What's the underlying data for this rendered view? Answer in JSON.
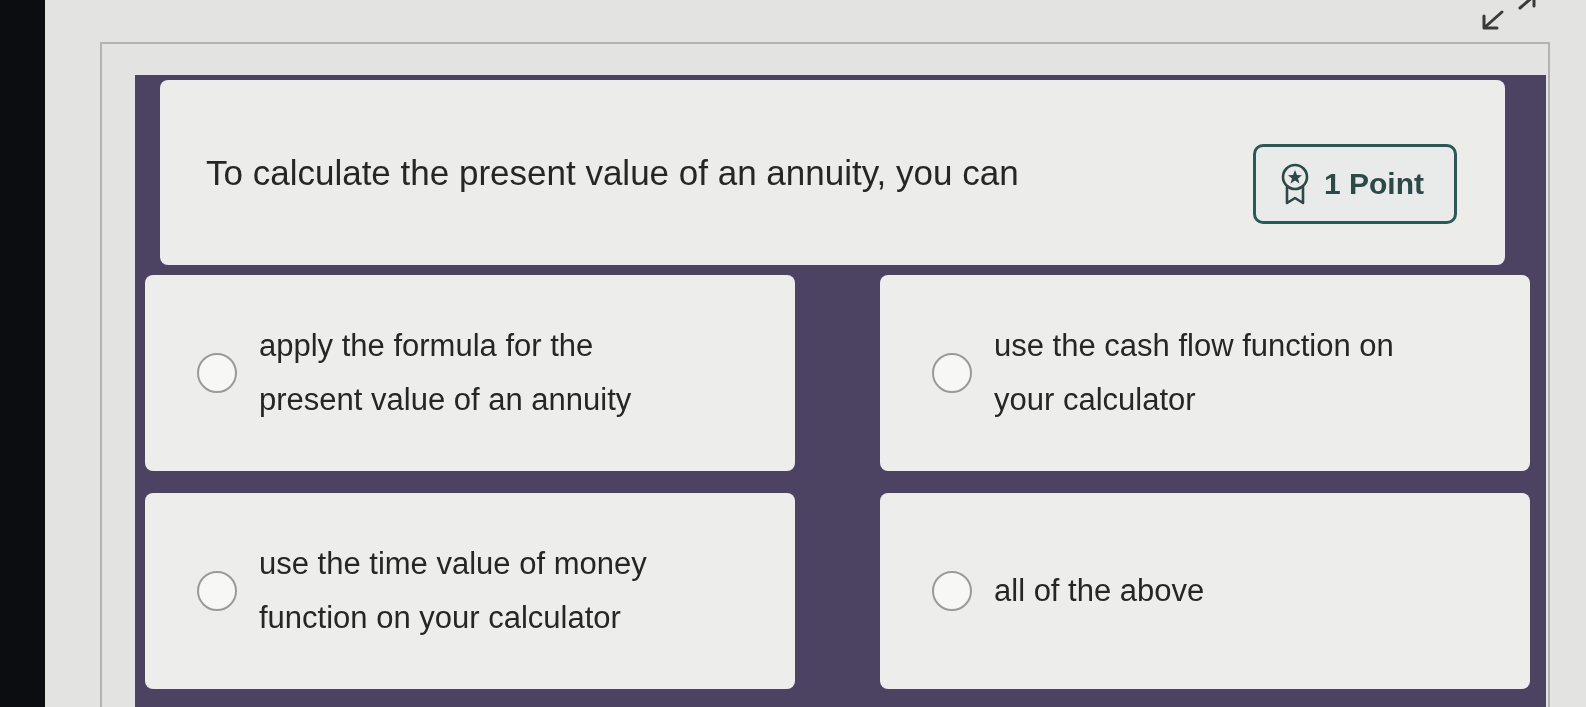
{
  "question": {
    "text": "To calculate the present value of an annuity, you can",
    "points": "1 Point"
  },
  "options": [
    {
      "text": "apply the formula for the present value of an annuity",
      "selected": false
    },
    {
      "text": "use the cash flow function on your calculator",
      "selected": false
    },
    {
      "text": "use the time value of money function on your calculator",
      "selected": false
    },
    {
      "text": "all of the above",
      "selected": false
    }
  ]
}
